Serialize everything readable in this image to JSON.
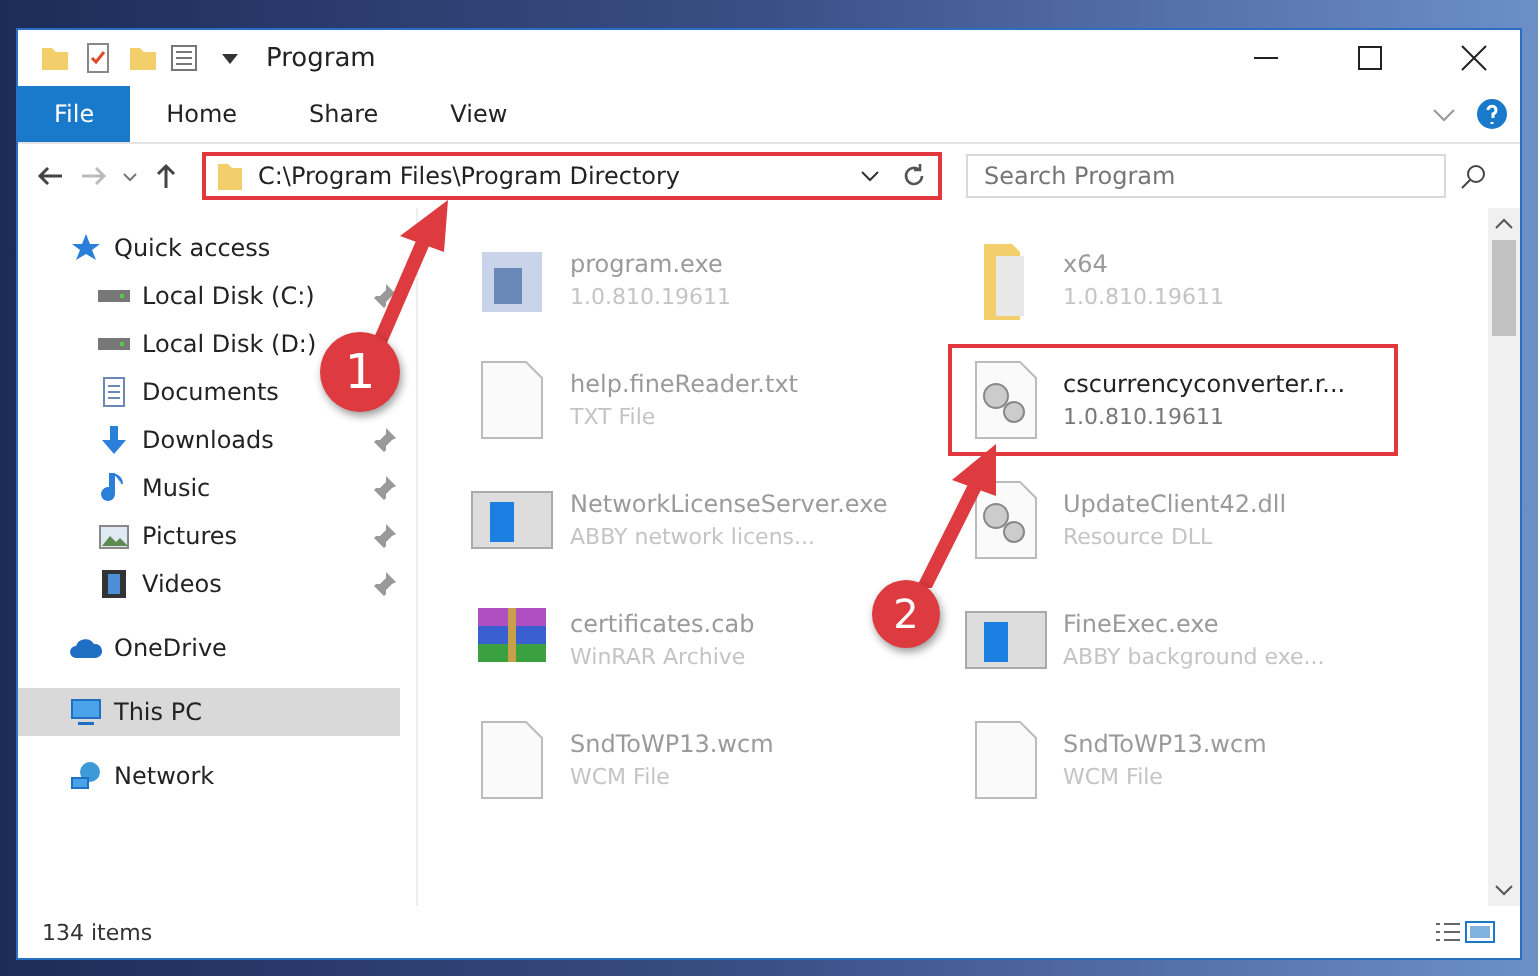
{
  "window": {
    "title": "Program"
  },
  "ribbon_tabs": [
    {
      "label": "File",
      "selected": true
    },
    {
      "label": "Home",
      "selected": false
    },
    {
      "label": "Share",
      "selected": false
    },
    {
      "label": "View",
      "selected": false
    }
  ],
  "address": {
    "path": "C:\\Program Files\\Program Directory",
    "highlighted": true
  },
  "search": {
    "placeholder": "Search Program"
  },
  "sidebar": {
    "items": [
      {
        "label": "Quick access",
        "kind": "star",
        "pinned": false,
        "selected": false,
        "children": [
          {
            "label": "Local Disk (C:)",
            "kind": "disk",
            "pinned": true,
            "selected": false
          },
          {
            "label": "Local Disk (D:)",
            "kind": "disk",
            "pinned": false,
            "selected": false
          },
          {
            "label": "Documents",
            "kind": "document",
            "pinned": false,
            "selected": false
          },
          {
            "label": "Downloads",
            "kind": "download",
            "pinned": true,
            "selected": false
          },
          {
            "label": "Music",
            "kind": "music",
            "pinned": true,
            "selected": false
          },
          {
            "label": "Pictures",
            "kind": "pictures",
            "pinned": true,
            "selected": false
          },
          {
            "label": "Videos",
            "kind": "videos",
            "pinned": true,
            "selected": false
          }
        ]
      },
      {
        "label": "OneDrive",
        "kind": "cloud",
        "pinned": false,
        "selected": false
      },
      {
        "label": "This PC",
        "kind": "pc",
        "pinned": false,
        "selected": true
      },
      {
        "label": "Network",
        "kind": "network",
        "pinned": false,
        "selected": false
      }
    ]
  },
  "files": [
    {
      "name": "program.exe",
      "detail": "1.0.810.19611",
      "kind": "app",
      "highlighted": false,
      "blurred": true
    },
    {
      "name": "x64",
      "detail": "1.0.810.19611",
      "kind": "folder",
      "highlighted": false,
      "blurred": true
    },
    {
      "name": "help.fineReader.txt",
      "detail": "TXT File",
      "kind": "text",
      "highlighted": false,
      "blurred": true
    },
    {
      "name": "cscurrencyconverter.r...",
      "detail": "1.0.810.19611",
      "kind": "settings",
      "highlighted": true,
      "blurred": false
    },
    {
      "name": "NetworkLicenseServer.exe",
      "detail": "ABBY network licens...",
      "kind": "window",
      "highlighted": false,
      "blurred": true
    },
    {
      "name": "UpdateClient42.dll",
      "detail": "Resource DLL",
      "kind": "settings",
      "highlighted": false,
      "blurred": true
    },
    {
      "name": "certificates.cab",
      "detail": "WinRAR Archive",
      "kind": "archive",
      "highlighted": false,
      "blurred": true
    },
    {
      "name": "FineExec.exe",
      "detail": "ABBY background exe...",
      "kind": "window",
      "highlighted": false,
      "blurred": true
    },
    {
      "name": "SndToWP13.wcm",
      "detail": "WCM File",
      "kind": "text",
      "highlighted": false,
      "blurred": true
    },
    {
      "name": "SndToWP13.wcm",
      "detail": "WCM File",
      "kind": "text",
      "highlighted": false,
      "blurred": true
    }
  ],
  "status_bar": {
    "items": "134 items"
  },
  "annotations": [
    {
      "number": "1"
    },
    {
      "number": "2"
    }
  ]
}
